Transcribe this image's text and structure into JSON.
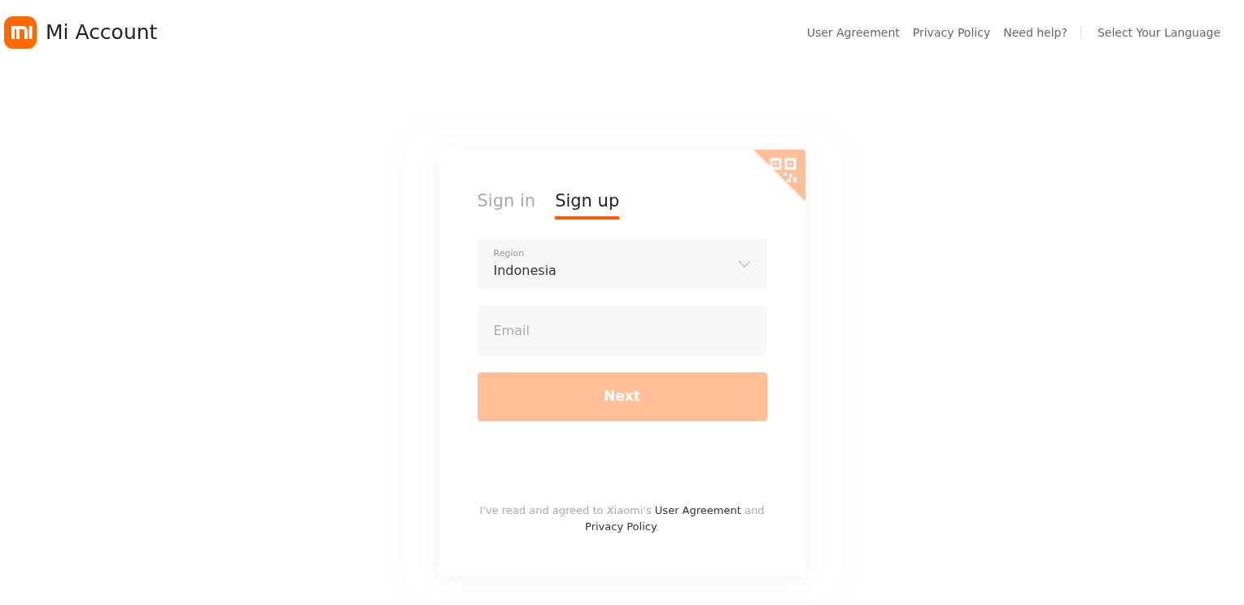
{
  "header": {
    "title": "Mi Account",
    "links": [
      "User Agreement",
      "Privacy Policy",
      "Need help?"
    ],
    "language": "Select Your Language"
  },
  "tabs": [
    {
      "label": "Sign in",
      "selected": false
    },
    {
      "label": "Sign up",
      "selected": true
    }
  ],
  "region": {
    "label": "Region",
    "value": "Indonesia"
  },
  "email": {
    "placeholder": "Email"
  },
  "next_button": {
    "label": "Next",
    "disabled": true
  },
  "agreement": [
    {
      "kind": "text",
      "text": "I've read and agreed to Xiaomi's "
    },
    {
      "kind": "link",
      "text": "User Agreement"
    },
    {
      "kind": "text",
      "text": " and "
    },
    {
      "kind": "link",
      "text": "Privacy Policy"
    },
    {
      "kind": "text",
      "text": "."
    }
  ]
}
